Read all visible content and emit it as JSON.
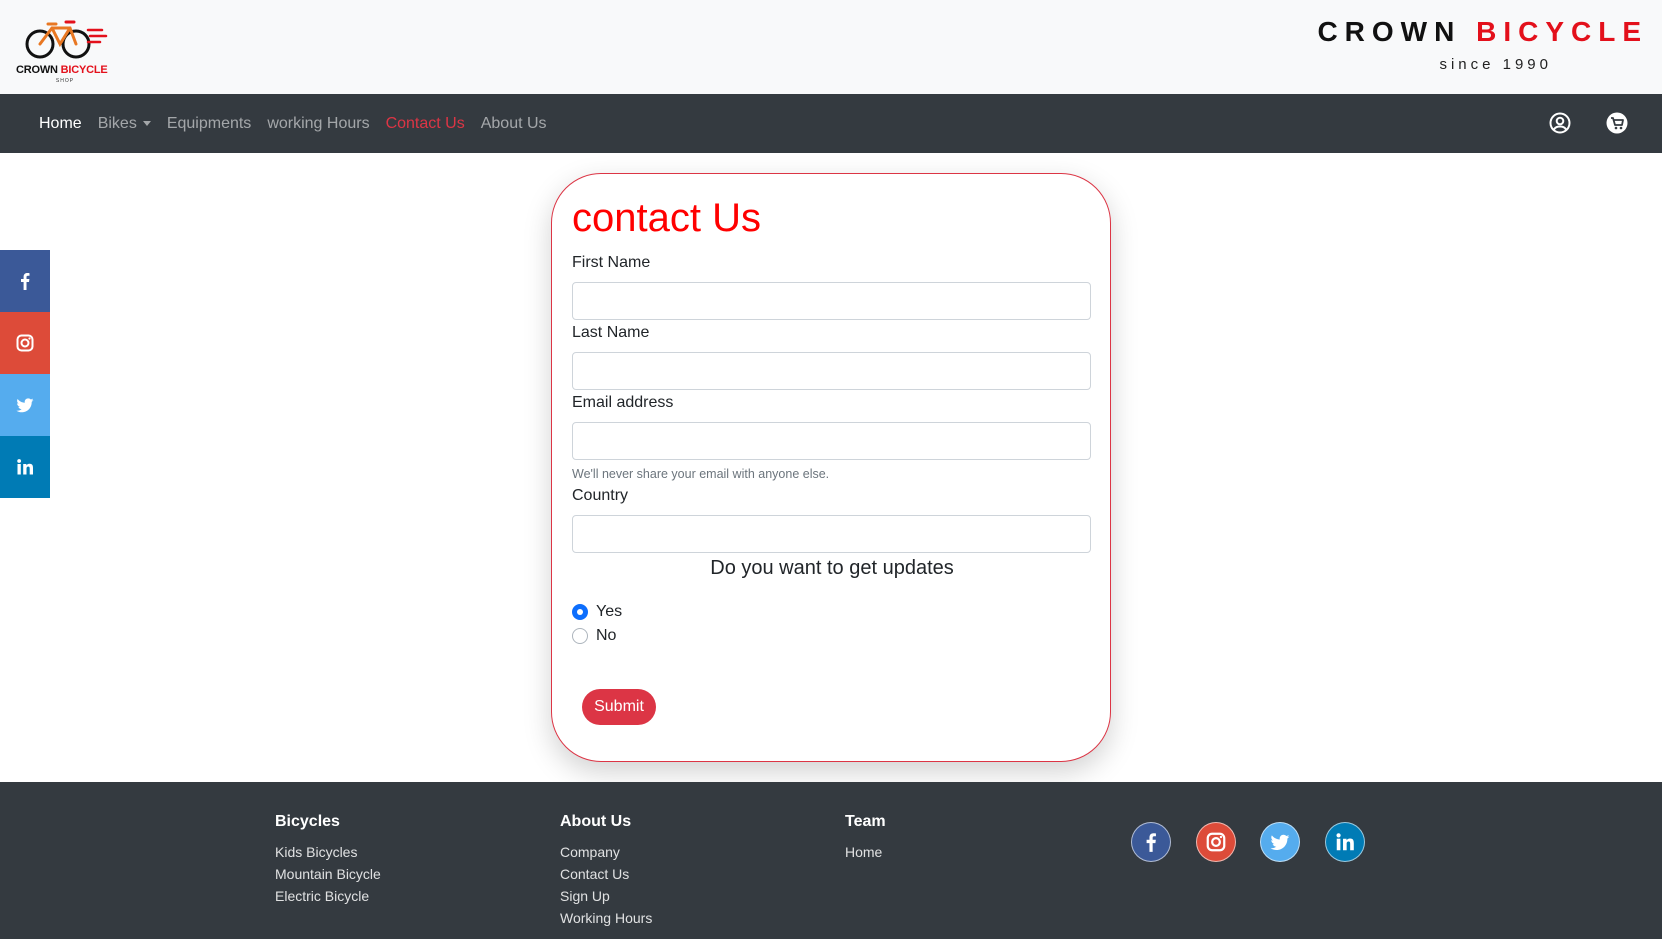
{
  "header": {
    "logo": {
      "name_dark": "CROWN",
      "name_red": "BICYCLE",
      "sub": "SHOP"
    },
    "brand": {
      "title_dark": "CROWN",
      "title_red": "BICYCLE",
      "since": "since 1990"
    }
  },
  "nav": {
    "items": [
      {
        "label": "Home"
      },
      {
        "label": "Bikes"
      },
      {
        "label": "Equipments"
      },
      {
        "label": "working Hours"
      },
      {
        "label": "Contact Us"
      },
      {
        "label": "About Us"
      }
    ],
    "icons": [
      "user-circle-icon",
      "cart-icon"
    ]
  },
  "social_sidebar": [
    "facebook-icon",
    "instagram-icon",
    "twitter-icon",
    "linkedin-icon"
  ],
  "form": {
    "title": "contact Us",
    "first_name": {
      "label": "First Name",
      "value": ""
    },
    "last_name": {
      "label": "Last Name",
      "value": ""
    },
    "email": {
      "label": "Email address",
      "value": "",
      "help": "We'll never share your email with anyone else."
    },
    "country": {
      "label": "Country",
      "value": ""
    },
    "updates_question": "Do you want to get updates",
    "options": [
      {
        "label": "Yes",
        "checked": true
      },
      {
        "label": "No",
        "checked": false
      }
    ],
    "submit_label": "Submit"
  },
  "footer": {
    "columns": [
      {
        "heading": "Bicycles",
        "links": [
          "Kids Bicycles",
          "Mountain Bicycle",
          "Electric Bicycle"
        ]
      },
      {
        "heading": "About Us",
        "links": [
          "Company",
          "Contact Us",
          "Sign Up",
          "Working Hours"
        ]
      },
      {
        "heading": "Team",
        "links": [
          "Home"
        ]
      }
    ],
    "social": [
      "facebook-icon",
      "instagram-icon",
      "twitter-icon",
      "linkedin-icon"
    ]
  },
  "colors": {
    "accent": "#dc3545",
    "title_red": "#ff0000",
    "navbar": "#343a40",
    "radio_checked": "#0d6efd",
    "facebook": "#3b5998",
    "instagram": "#dd4b39",
    "twitter": "#55acee",
    "linkedin": "#007bb5"
  }
}
